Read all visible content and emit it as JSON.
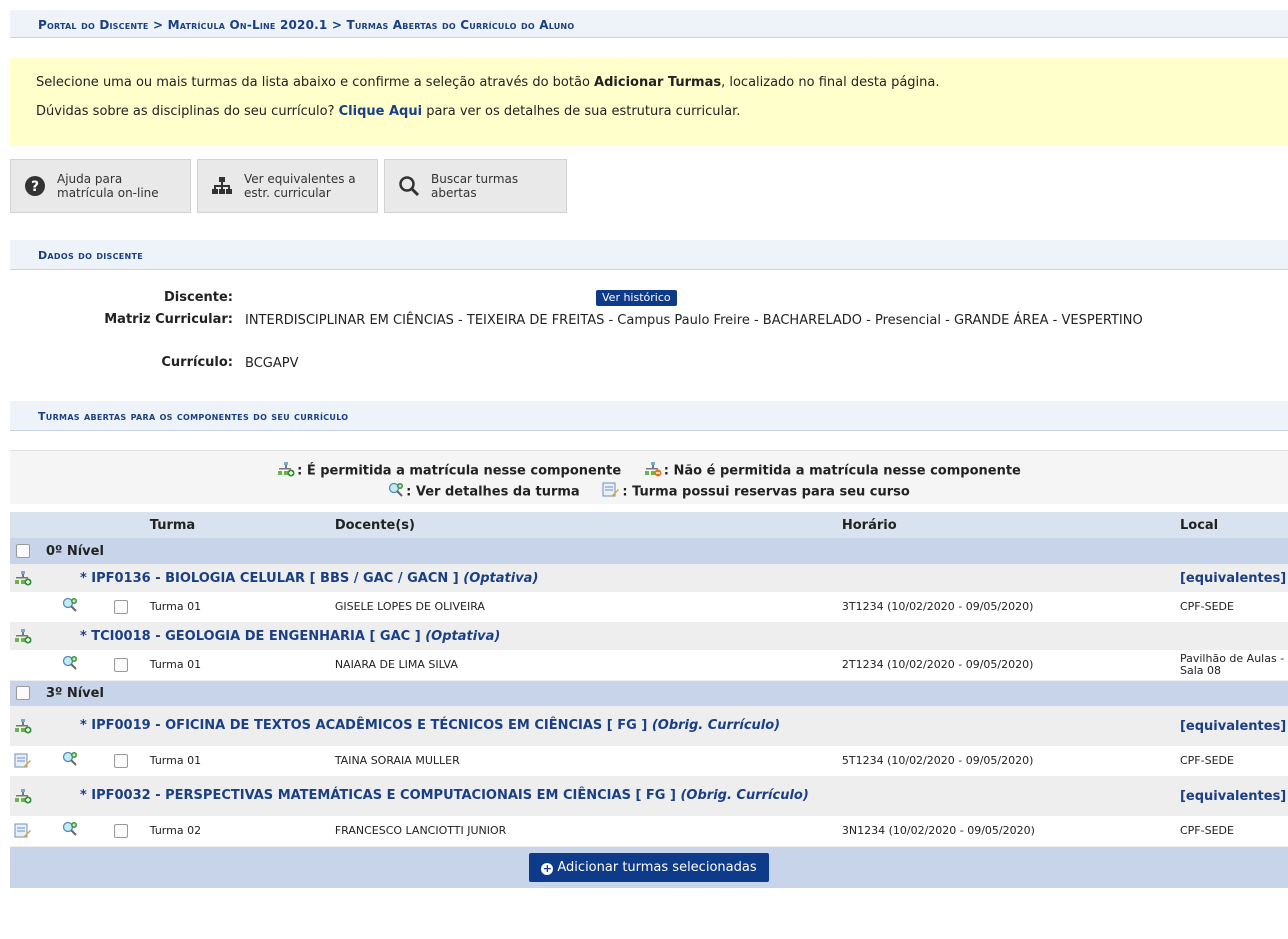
{
  "breadcrumb": "Portal do Discente > Matrícula On-Line 2020.1 > Turmas Abertas do Currículo do Aluno",
  "notice": {
    "line1_pre": "Selecione uma ou mais turmas da lista abaixo e confirme a seleção através do botão ",
    "line1_bold": "Adicionar Turmas",
    "line1_post": ", localizado no final desta página.",
    "line2_pre": "Dúvidas sobre as disciplinas do seu currículo? ",
    "line2_link": "Clique Aqui",
    "line2_post": " para ver os detalhes de sua estrutura curricular."
  },
  "toolbar": {
    "help_line1": "Ajuda para",
    "help_line2": "matrícula on-line",
    "equiv_line1": "Ver equivalentes a",
    "equiv_line2": "estr. curricular",
    "search_line1": "Buscar turmas",
    "search_line2": "abertas"
  },
  "dados": {
    "title": "Dados do discente",
    "discente_label": "Discente:",
    "historico_button": "Ver histórico",
    "matriz_label": "Matriz Curricular:",
    "matriz_value": "INTERDISCIPLINAR EM CIÊNCIAS - TEIXEIRA DE FREITAS - Campus Paulo Freire - BACHARELADO - Presencial - GRANDE ÁREA - VESPERTINO",
    "curriculo_label": "Currículo:",
    "curriculo_value": "BCGAPV"
  },
  "turmas_section_title": "Turmas abertas para os componentes do seu currículo",
  "legend": {
    "allowed": ": É permitida a matrícula nesse componente",
    "not_allowed": ": Não é permitida a matrícula nesse componente",
    "details": ": Ver detalhes da turma",
    "reserves": ": Turma possui reservas para seu curso"
  },
  "table": {
    "headers": {
      "turma": "Turma",
      "docentes": "Docente(s)",
      "horario": "Horário",
      "local": "Local"
    },
    "nivel0": "0º Nível",
    "nivel3": "3º Nível",
    "comp1": {
      "name": "* IPF0136 - BIOLOGIA CELULAR [ BBS / GAC / GACN ] ",
      "type": "(Optativa)",
      "equiv": "[equivalentes]"
    },
    "turma1": {
      "turma": "Turma 01",
      "docente": "GISELE LOPES DE OLIVEIRA",
      "horario": "3T1234 (10/02/2020 - 09/05/2020)",
      "local": "CPF-SEDE"
    },
    "comp2": {
      "name": "* TCI0018 - GEOLOGIA DE ENGENHARIA [ GAC ] ",
      "type": "(Optativa)"
    },
    "turma2": {
      "turma": "Turma 01",
      "docente": "NAIARA DE LIMA SILVA",
      "horario": "2T1234 (10/02/2020 - 09/05/2020)",
      "local": "Pavilhão de Aulas - Sala 08"
    },
    "comp3": {
      "name": "* IPF0019 - OFICINA DE TEXTOS ACADÊMICOS E TÉCNICOS EM CIÊNCIAS [ FG ] ",
      "type": "(Obrig. Currículo)",
      "equiv": "[equivalentes]"
    },
    "turma3": {
      "turma": "Turma 01",
      "docente": "TAINA SORAIA MULLER",
      "horario": "5T1234 (10/02/2020 - 09/05/2020)",
      "local": "CPF-SEDE"
    },
    "comp4": {
      "name": "* IPF0032 - PERSPECTIVAS MATEMÁTICAS E COMPUTACIONAIS EM CIÊNCIAS [ FG ] ",
      "type": "(Obrig. Currículo)",
      "equiv": "[equivalentes]"
    },
    "turma4": {
      "turma": "Turma 02",
      "docente": "FRANCESCO LANCIOTTI JUNIOR",
      "horario": "3N1234 (10/02/2020 - 09/05/2020)",
      "local": "CPF-SEDE"
    }
  },
  "add_button": "Adicionar turmas selecionadas",
  "colors": {
    "brand": "#1a3f85",
    "button": "#0e3a8a",
    "notice_bg": "#ffffcc",
    "nivel_bg": "#c8d4ea"
  }
}
